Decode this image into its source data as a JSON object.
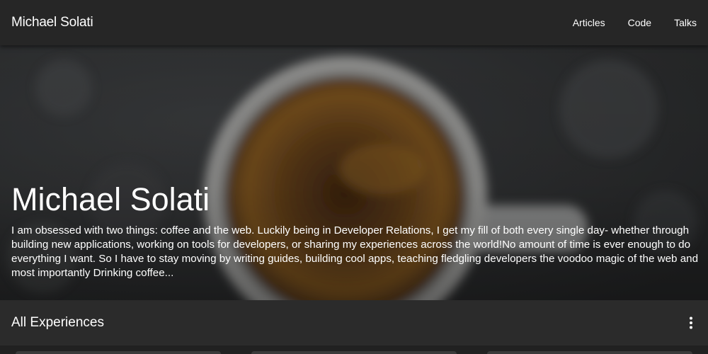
{
  "app": {
    "brand": "Michael Solati"
  },
  "nav": {
    "items": [
      {
        "label": "Articles"
      },
      {
        "label": "Code"
      },
      {
        "label": "Talks"
      }
    ]
  },
  "hero": {
    "title": "Michael Solati",
    "description": "I am obsessed with two things: coffee and the web. Luckily being in Developer Relations, I get my fill of both every single day- whether through building new applications, working on tools for developers, or sharing my experiences across the world!No amount of time is ever enough to do everything I want. So I have to stay moving by writing guides, building cool apps, teaching fledgling developers the voodoo magic of the web and most importantly Drinking coffee..."
  },
  "section": {
    "title": "All Experiences",
    "menu_icon": "more-vert-icon"
  },
  "colors": {
    "topbar": "#262626",
    "background": "#212121",
    "section_bar": "#2b2b2b",
    "text": "#ffffff"
  }
}
